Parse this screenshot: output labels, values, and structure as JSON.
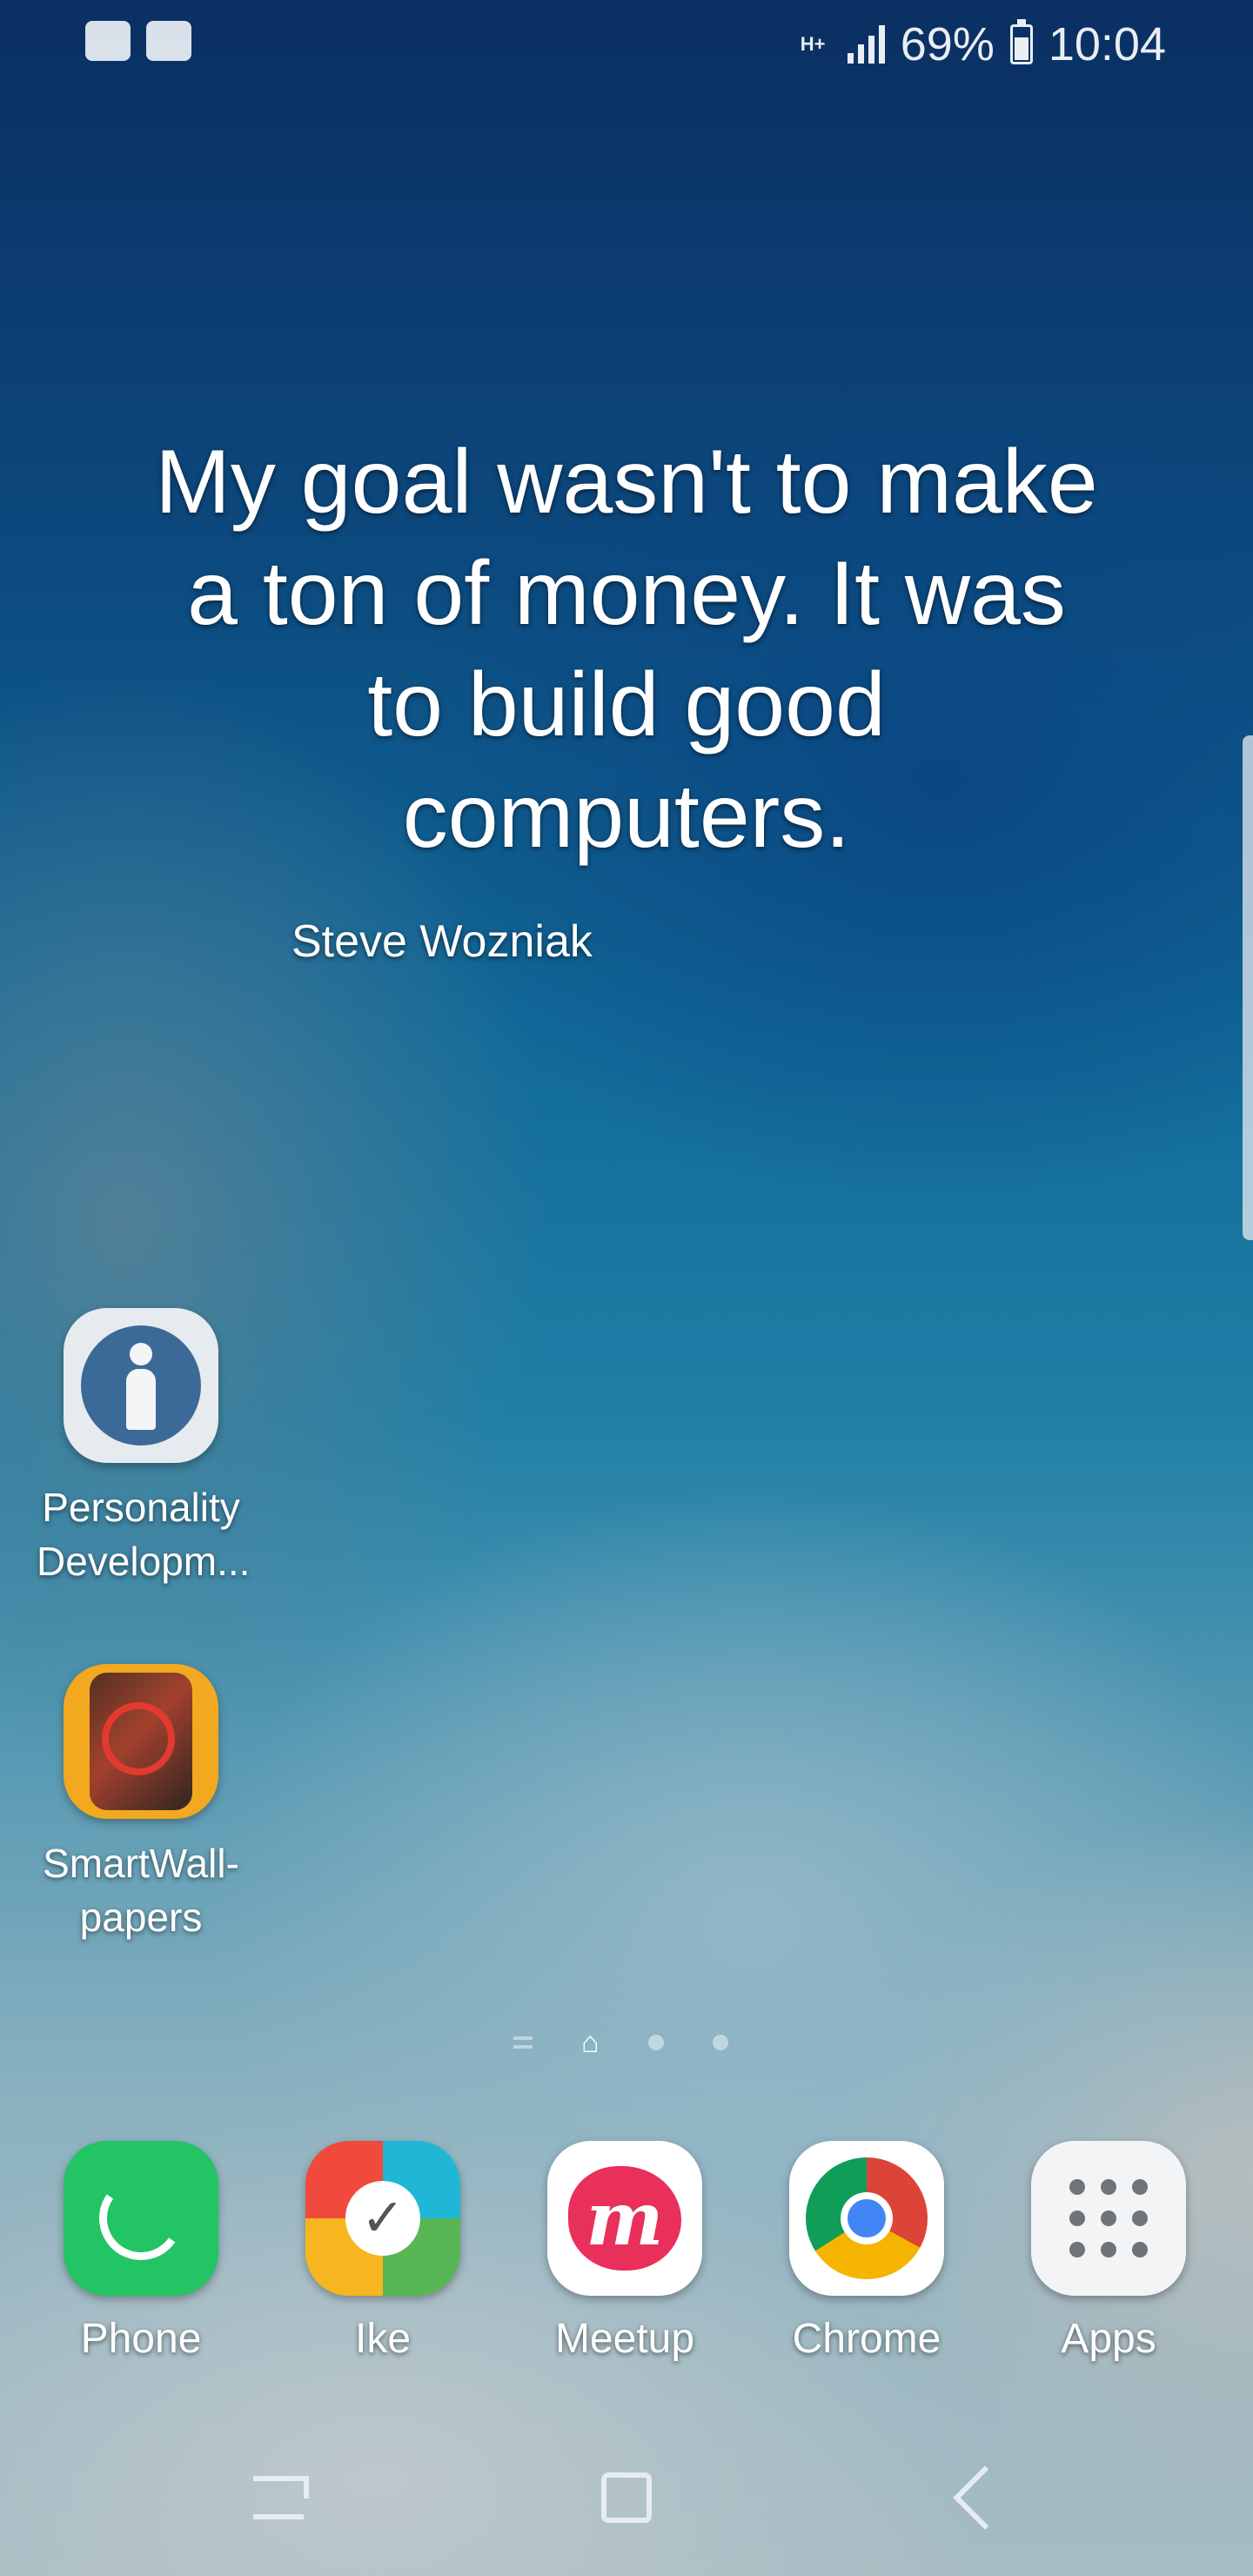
{
  "status_bar": {
    "left_icons": [
      "activity-monitor-icon",
      "wifi-icon"
    ],
    "network_type": "H+",
    "battery_percent": "69%",
    "time": "10:04"
  },
  "quote_widget": {
    "quote": "My goal wasn't to make a ton of money. It was to build good computers.",
    "author": "Steve Wozniak"
  },
  "home_apps": [
    {
      "label": "Personality Developm...",
      "icon": "personality-development-icon"
    },
    {
      "label": "SmartWall-papers",
      "icon": "smartwallpapers-icon"
    }
  ],
  "page_indicator": {
    "pages": 4,
    "current": "home"
  },
  "dock": [
    {
      "label": "Phone",
      "icon": "phone-icon",
      "color": "#22c464"
    },
    {
      "label": "Ike",
      "icon": "ike-icon"
    },
    {
      "label": "Meetup",
      "icon": "meetup-icon",
      "color": "#e8305a"
    },
    {
      "label": "Chrome",
      "icon": "chrome-icon"
    },
    {
      "label": "Apps",
      "icon": "apps-grid-icon"
    }
  ],
  "navigation": [
    "recent-apps-icon",
    "home-icon",
    "back-icon"
  ]
}
